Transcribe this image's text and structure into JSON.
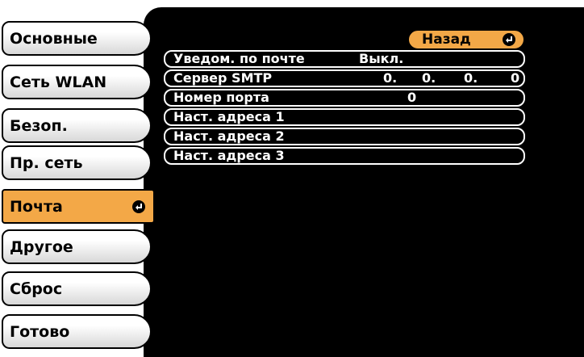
{
  "sidebar": {
    "items": [
      {
        "label": "Основные"
      },
      {
        "label": "Сеть WLAN"
      },
      {
        "label": "Безоп."
      },
      {
        "label": "Пр. сеть"
      },
      {
        "label": "Почта"
      },
      {
        "label": "Другое"
      },
      {
        "label": "Сброс"
      },
      {
        "label": "Готово"
      }
    ],
    "active_item": "Почта"
  },
  "panel": {
    "back_button_label": "Назад",
    "rows": [
      {
        "label": "Уведом. по почте",
        "value": "Выкл."
      },
      {
        "label": "Сервер SMTP",
        "octets": [
          "0.",
          "0.",
          "0.",
          "0"
        ]
      },
      {
        "label": "Номер порта",
        "value": "0"
      },
      {
        "label": "Наст. адреса 1"
      },
      {
        "label": "Наст. адреса 2"
      },
      {
        "label": "Наст. адреса 3"
      }
    ]
  },
  "colors": {
    "accent": "#f3a847",
    "panel_bg": "#000000",
    "item_bg": "#ffffff"
  }
}
